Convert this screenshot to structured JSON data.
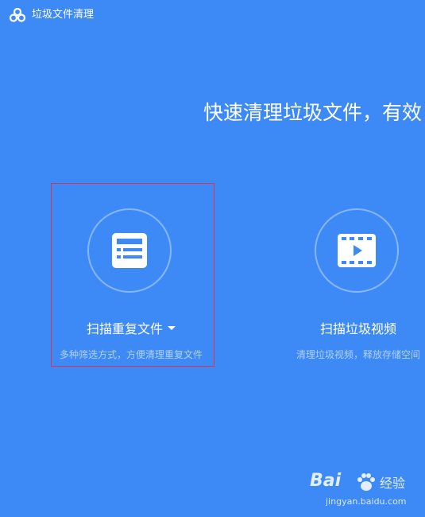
{
  "window": {
    "title": "垃圾文件清理",
    "logo_icon": "cloud-logo-icon"
  },
  "main": {
    "headline": "快速清理垃圾文件，有效"
  },
  "cards": [
    {
      "icon": "document-list-icon",
      "label": "扫描重复文件",
      "has_dropdown": true,
      "description": "多种筛选方式，方便清理重复文件"
    },
    {
      "icon": "video-film-icon",
      "label": "扫描垃圾视频",
      "description": "清理垃圾视频，释放存储空间"
    }
  ],
  "watermark": {
    "brand": "Bai",
    "brand_suffix": "经验",
    "url": "jingyan.baidu.com"
  },
  "colors": {
    "background": "#3d8af7",
    "selection_border": "#e0334a"
  }
}
